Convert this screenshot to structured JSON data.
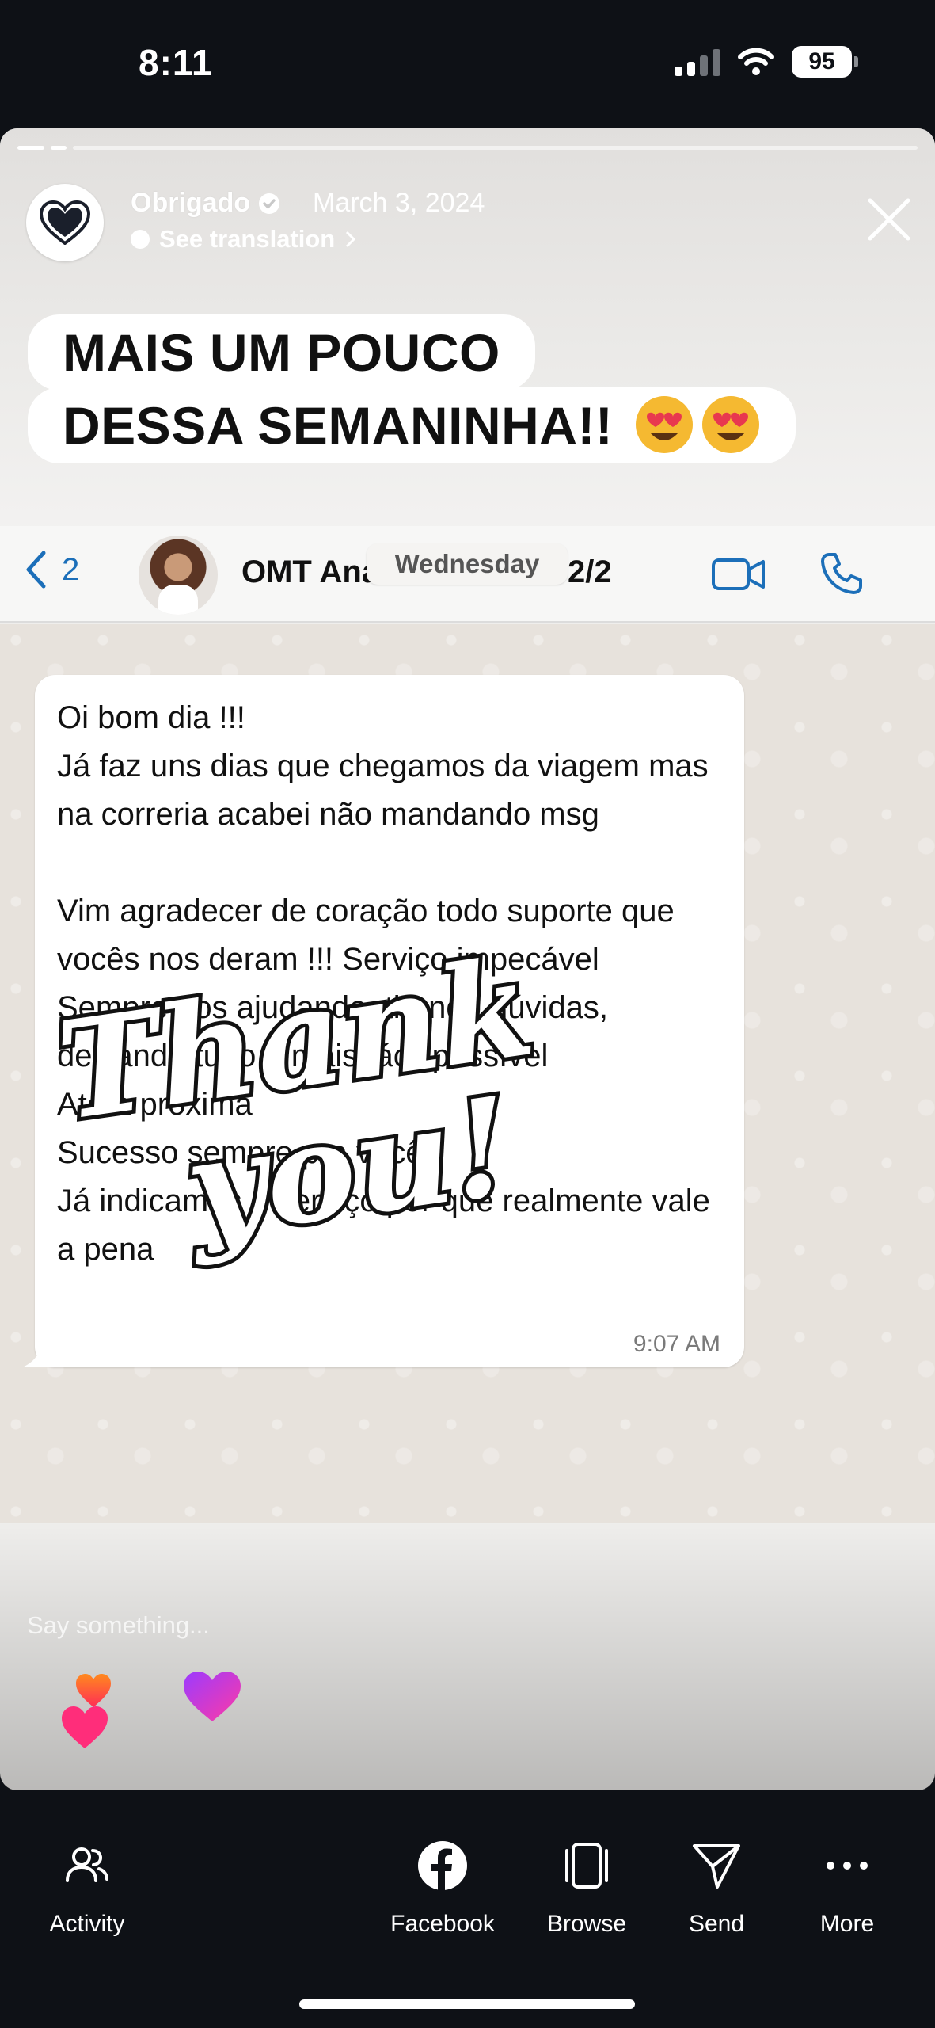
{
  "status_bar": {
    "time": "8:11",
    "battery": "95"
  },
  "story": {
    "poster_name": "Obrigado",
    "date": "March 3, 2024",
    "translate_label": "See translation",
    "headline_line1": "MAIS UM POUCO",
    "headline_line2": "DESSA SEMANINHA!!",
    "say_something": "Say something...",
    "progress_segments": 2,
    "active_segment": 2
  },
  "whatsapp": {
    "back_count": "2",
    "contact_name": "OMT Analice Ferreira 2/2",
    "day_chip": "Wednesday",
    "message": "Oi bom dia !!!\nJá faz uns dias que chegamos da viagem mas na correria acabei não mandando msg\n\nVim agradecer de coração todo suporte que vocês nos deram !!! Serviço impecável\nSempre nos ajudando, tirando dúvidas, deixando tudo o mais fácil possível\nAté a próxima\nSucesso sempre pra vocês\nJá indicamos o serviço por que realmente vale a pena",
    "message_time": "9:07 AM"
  },
  "sticker": {
    "line1": "Thank",
    "line2": "you!"
  },
  "bottom_nav": {
    "activity": "Activity",
    "facebook": "Facebook",
    "browse": "Browse",
    "send": "Send",
    "more": "More"
  },
  "colors": {
    "wa_accent": "#1c6fb9",
    "background": "#0e1116"
  }
}
